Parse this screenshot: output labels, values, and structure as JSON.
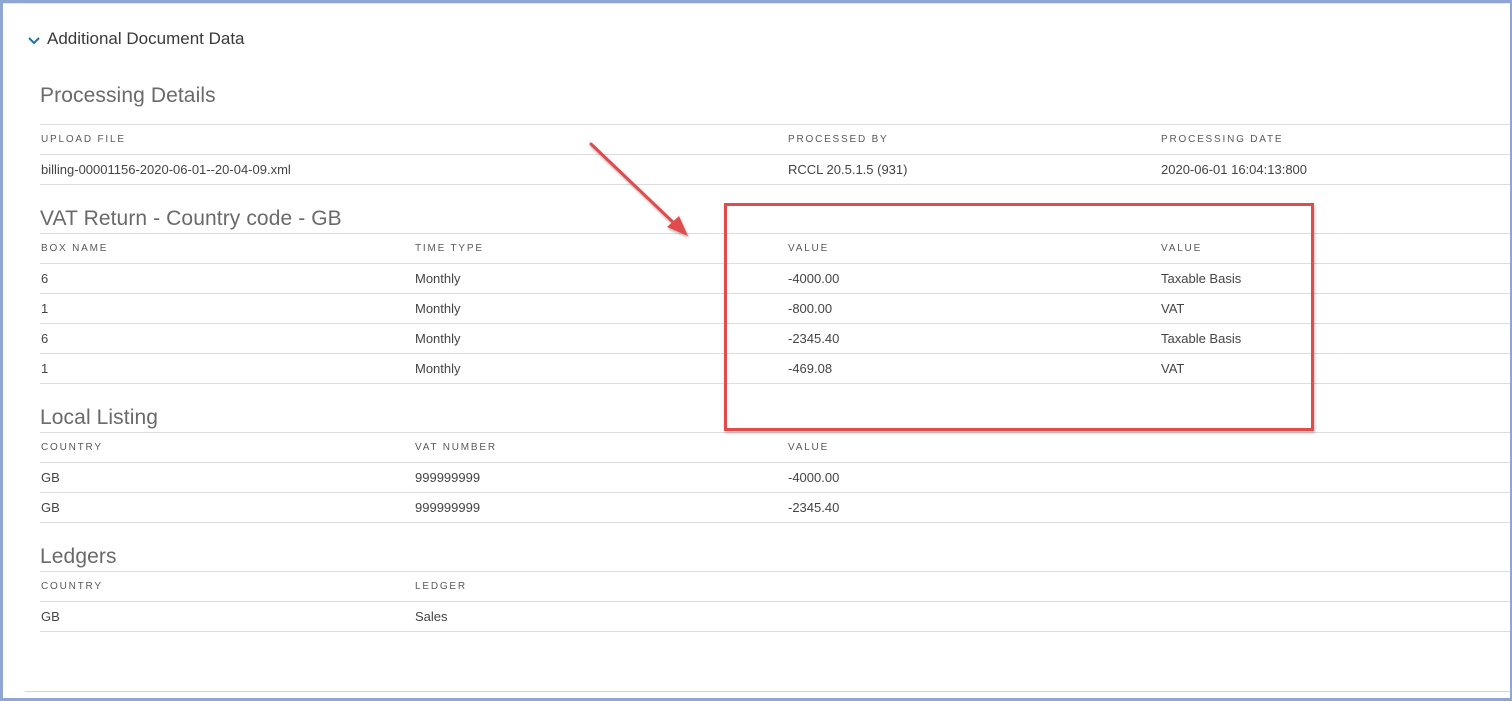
{
  "section": {
    "title": "Additional Document Data"
  },
  "processing": {
    "title": "Processing Details",
    "headers": [
      "UPLOAD FILE",
      "",
      "PROCESSED BY",
      "PROCESSING DATE"
    ],
    "rows": [
      [
        "billing-00001156-2020-06-01--20-04-09.xml",
        "",
        "RCCL 20.5.1.5 (931)",
        "2020-06-01 16:04:13:800"
      ]
    ]
  },
  "vat": {
    "title": "VAT Return - Country code - GB",
    "headers": [
      "BOX NAME",
      "TIME TYPE",
      "VALUE",
      "VALUE"
    ],
    "rows": [
      [
        "6",
        "Monthly",
        "-4000.00",
        "Taxable Basis"
      ],
      [
        "1",
        "Monthly",
        "-800.00",
        "VAT"
      ],
      [
        "6",
        "Monthly",
        "-2345.40",
        "Taxable Basis"
      ],
      [
        "1",
        "Monthly",
        "-469.08",
        "VAT"
      ]
    ]
  },
  "local": {
    "title": "Local Listing",
    "headers": [
      "COUNTRY",
      "VAT NUMBER",
      "VALUE",
      ""
    ],
    "rows": [
      [
        "GB",
        "999999999",
        "-4000.00",
        ""
      ],
      [
        "GB",
        "999999999",
        "-2345.40",
        ""
      ]
    ]
  },
  "ledgers": {
    "title": "Ledgers",
    "headers": [
      "COUNTRY",
      "LEDGER",
      "",
      ""
    ],
    "rows": [
      [
        "GB",
        "Sales",
        "",
        ""
      ]
    ]
  },
  "colors": {
    "annotation": "#e04b4b",
    "accent": "#1f6fa8",
    "frame": "#8fa6d4"
  },
  "icons": {
    "section_toggle": "chevron-down-icon"
  }
}
